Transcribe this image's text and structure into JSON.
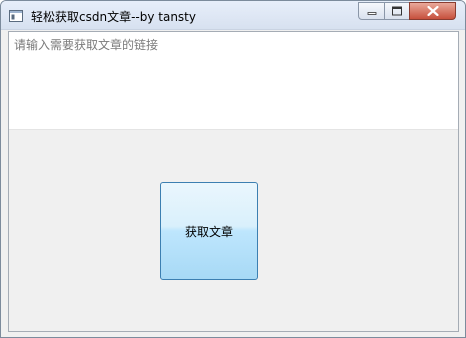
{
  "window": {
    "title": "轻松获取csdn文章--by tansty"
  },
  "titlebar_controls": {
    "minimize": "minimize-icon",
    "maximize": "maximize-icon",
    "close": "close-icon"
  },
  "input": {
    "value": "",
    "placeholder": "请输入需要获取文章的链接"
  },
  "action": {
    "fetch_label": "获取文章"
  },
  "colors": {
    "close_button": "#c7503c",
    "button_border": "#3c7fb1",
    "button_fill": "#bee6fd"
  }
}
